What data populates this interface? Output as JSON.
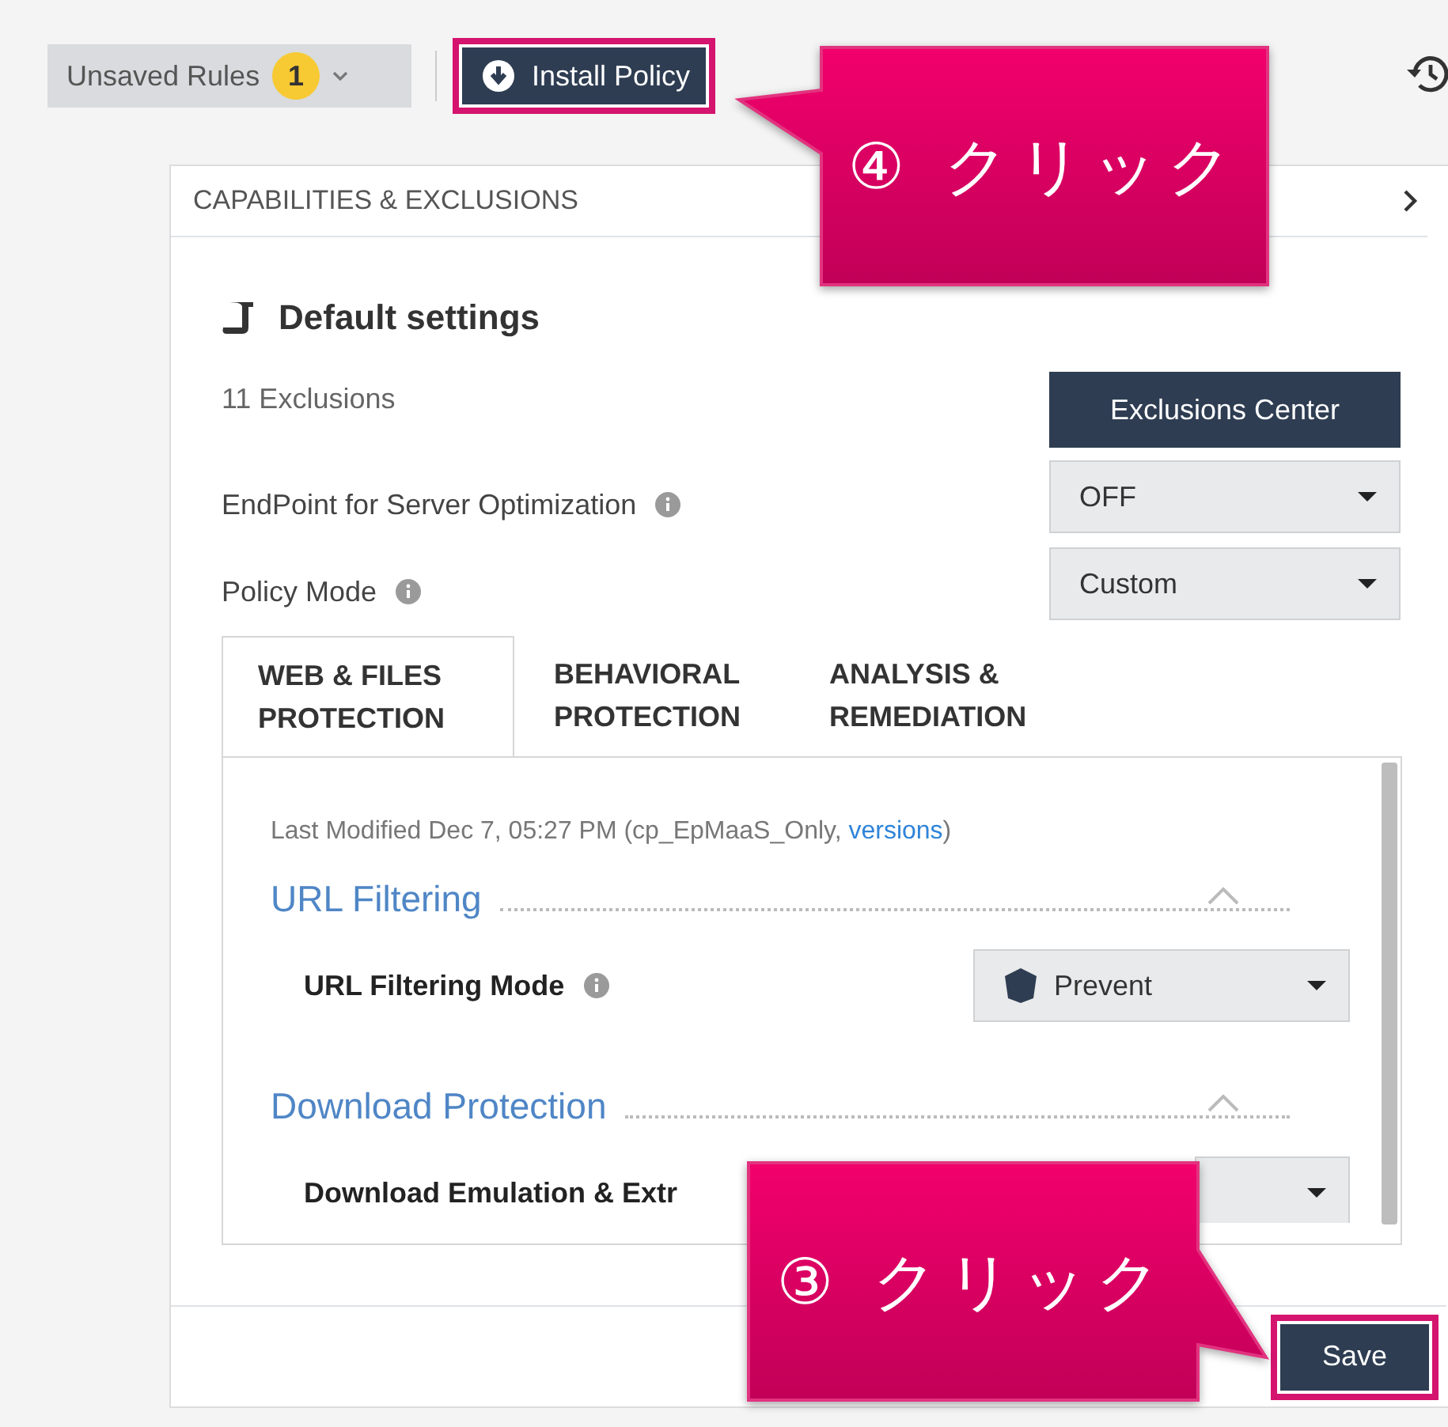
{
  "toolbar": {
    "unsaved_rules": {
      "label": "Unsaved Rules",
      "count": "1"
    },
    "install_button": {
      "label": "Install Policy",
      "highlighted": true
    }
  },
  "panel": {
    "title": "CAPABILITIES & EXCLUSIONS",
    "heading": "Default settings",
    "exclusions_count": "11 Exclusions",
    "exclusions_button": "Exclusions Center",
    "settings": [
      {
        "label": "EndPoint for Server Optimization",
        "info": true,
        "value": "OFF"
      },
      {
        "label": "Policy Mode",
        "info": true,
        "value": "Custom"
      }
    ],
    "tabs": [
      {
        "label": "WEB & FILES\nPROTECTION",
        "selected": true
      },
      {
        "label": "BEHAVIORAL\nPROTECTION",
        "selected": false
      },
      {
        "label": "ANALYSIS &\nREMEDIATION",
        "selected": false
      }
    ],
    "last_modified": {
      "text": "Last Modified Dec 7, 05:27 PM (cp_EpMaaS_Only, ",
      "link": "versions",
      "end": ")"
    },
    "sections": [
      {
        "title": "URL Filtering",
        "expanded": true,
        "setting": {
          "label": "URL Filtering Mode",
          "info": true,
          "value": "Prevent",
          "kind": "shield"
        }
      },
      {
        "title": "Download Protection",
        "expanded": true,
        "setting": {
          "label": "Download Emulation & Extr",
          "info": false,
          "kind": "plain"
        }
      }
    ],
    "save_button": {
      "label": "Save",
      "highlighted": true
    }
  },
  "callouts": [
    {
      "text": "④ クリック",
      "kind": "left"
    },
    {
      "text": "③ クリック",
      "kind": "right"
    }
  ]
}
